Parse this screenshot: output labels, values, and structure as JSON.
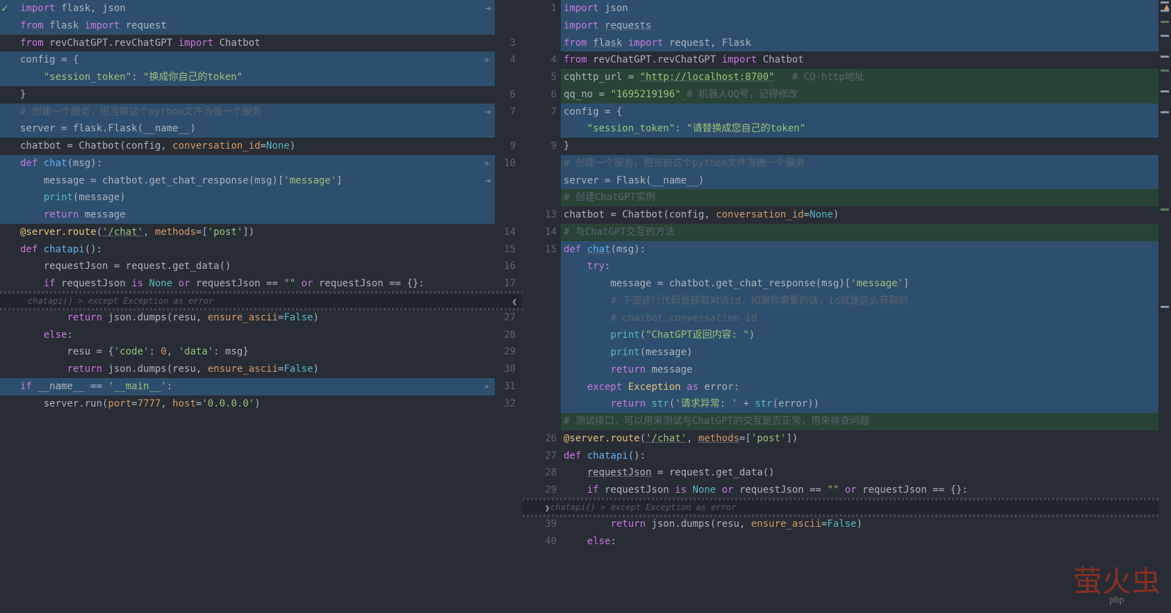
{
  "watermark_main": "萤火虫",
  "watermark_sub": "php",
  "fold_text": "chatapi() > except Exception as error",
  "left": [
    {
      "n": "",
      "t": [
        [
          "kw",
          "import"
        ],
        [
          "plain",
          " flask"
        ],
        [
          "op",
          ", "
        ],
        [
          "plain",
          "json"
        ]
      ],
      "cls": "hl-blue",
      "act": "replace",
      "lm": true
    },
    {
      "n": "",
      "t": [
        [
          "kw",
          "from"
        ],
        [
          "plain",
          " flask "
        ],
        [
          "kw",
          "import"
        ],
        [
          "plain",
          " request"
        ]
      ],
      "cls": "hl-blue",
      "lm": true
    },
    {
      "n": "3",
      "t": [
        [
          "kw",
          "from"
        ],
        [
          "plain",
          " revChatGPT.revChatGPT "
        ],
        [
          "kw",
          "import"
        ],
        [
          "plain",
          " Chatbot"
        ]
      ],
      "cls": ""
    },
    {
      "n": "4",
      "t": [
        [
          "plain",
          "config = {"
        ]
      ],
      "cls": "hl-blue",
      "skip": true,
      "lm": true
    },
    {
      "n": "",
      "t": [
        [
          "plain",
          "    "
        ],
        [
          "str",
          "\"session_token\""
        ],
        [
          "plain",
          ": "
        ],
        [
          "str",
          "\"换成你自己的token\""
        ]
      ],
      "cls": "hl-blue",
      "lm": true
    },
    {
      "n": "6",
      "t": [
        [
          "plain",
          "}"
        ]
      ],
      "cls": ""
    },
    {
      "n": "7",
      "t": [
        [
          "comment",
          "# 创建一个服务，把当前这个python文件当做一个服务"
        ]
      ],
      "cls": "hl-blue",
      "act": "replace",
      "lm": true
    },
    {
      "n": "",
      "t": [
        [
          "plain",
          "server = flask.Flask(__name__)"
        ]
      ],
      "cls": "hl-blue",
      "lm": true
    },
    {
      "n": "9",
      "t": [
        [
          "plain",
          "chatbot = Chatbot(config"
        ],
        [
          "op",
          ", "
        ],
        [
          "param",
          "conversation_id"
        ],
        [
          "plain",
          "="
        ],
        [
          "builtin",
          "None"
        ],
        [
          "plain",
          ")"
        ]
      ],
      "cls": ""
    },
    {
      "n": "10",
      "t": [
        [
          "kw",
          "def "
        ],
        [
          "fn",
          "chat"
        ],
        [
          "plain",
          "(msg):"
        ]
      ],
      "cls": "hl-blue",
      "skip": true,
      "lm": true
    },
    {
      "n": "",
      "t": [
        [
          "plain",
          "    message = chatbot.get_chat_response(msg)["
        ],
        [
          "str",
          "'message'"
        ],
        [
          "plain",
          "]"
        ]
      ],
      "cls": "hl-blue",
      "act": "replace",
      "lm": true
    },
    {
      "n": "",
      "t": [
        [
          "plain",
          "    "
        ],
        [
          "builtin",
          "print"
        ],
        [
          "plain",
          "(message)"
        ]
      ],
      "cls": "hl-blue",
      "lm": true
    },
    {
      "n": "",
      "t": [
        [
          "plain",
          "    "
        ],
        [
          "kw",
          "return"
        ],
        [
          "plain",
          " message"
        ]
      ],
      "cls": "hl-blue",
      "lm": true
    },
    {
      "n": "14",
      "t": [
        [
          "deco",
          "@server.route"
        ],
        [
          "plain",
          "("
        ],
        [
          "str und",
          "'/chat'"
        ],
        [
          "op",
          ", "
        ],
        [
          "param",
          "methods"
        ],
        [
          "plain",
          "=["
        ],
        [
          "str",
          "'post'"
        ],
        [
          "plain",
          "])"
        ]
      ],
      "cls": ""
    },
    {
      "n": "15",
      "t": [
        [
          "kw",
          "def "
        ],
        [
          "fn",
          "chatapi"
        ],
        [
          "plain",
          "():"
        ]
      ],
      "cls": ""
    },
    {
      "n": "16",
      "t": [
        [
          "plain",
          "    requestJson = request.get_data()"
        ]
      ],
      "cls": ""
    },
    {
      "n": "17",
      "t": [
        [
          "plain",
          "    "
        ],
        [
          "kw",
          "if"
        ],
        [
          "plain",
          " requestJson "
        ],
        [
          "kw",
          "is"
        ],
        [
          "plain",
          " "
        ],
        [
          "builtin",
          "None"
        ],
        [
          "plain",
          " "
        ],
        [
          "kw",
          "or"
        ],
        [
          "plain",
          " requestJson == "
        ],
        [
          "str",
          "\"\""
        ],
        [
          "plain",
          " "
        ],
        [
          "kw",
          "or"
        ],
        [
          "plain",
          " requestJson == {}:"
        ]
      ],
      "cls": ""
    },
    {
      "fold": true
    },
    {
      "n": "27",
      "t": [
        [
          "plain",
          "        "
        ],
        [
          "kw",
          "return"
        ],
        [
          "plain",
          " json.dumps(resu"
        ],
        [
          "op",
          ", "
        ],
        [
          "param",
          "ensure_ascii"
        ],
        [
          "plain",
          "="
        ],
        [
          "builtin",
          "False"
        ],
        [
          "plain",
          ")"
        ]
      ],
      "cls": ""
    },
    {
      "n": "28",
      "t": [
        [
          "plain",
          "    "
        ],
        [
          "kw",
          "else"
        ],
        [
          "plain",
          ":"
        ]
      ],
      "cls": ""
    },
    {
      "n": "29",
      "t": [
        [
          "plain",
          "        resu = {"
        ],
        [
          "str",
          "'code'"
        ],
        [
          "plain",
          ": "
        ],
        [
          "num",
          "0"
        ],
        [
          "op",
          ", "
        ],
        [
          "str",
          "'data'"
        ],
        [
          "plain",
          ": msg}"
        ]
      ],
      "cls": ""
    },
    {
      "n": "30",
      "t": [
        [
          "plain",
          "        "
        ],
        [
          "kw",
          "return"
        ],
        [
          "plain",
          " json.dumps(resu"
        ],
        [
          "op",
          ", "
        ],
        [
          "param",
          "ensure_ascii"
        ],
        [
          "plain",
          "="
        ],
        [
          "builtin",
          "False"
        ],
        [
          "plain",
          ")"
        ]
      ],
      "cls": ""
    },
    {
      "n": "31",
      "t": [
        [
          "kw",
          "if"
        ],
        [
          "plain",
          " __name__ == "
        ],
        [
          "str",
          "'__main__'"
        ],
        [
          "plain",
          ":"
        ]
      ],
      "cls": "hl-blue",
      "skip": true,
      "lm": true
    },
    {
      "n": "32",
      "t": [
        [
          "plain",
          "    server.run("
        ],
        [
          "param",
          "port"
        ],
        [
          "plain",
          "="
        ],
        [
          "num",
          "7777"
        ],
        [
          "op",
          ", "
        ],
        [
          "param",
          "host"
        ],
        [
          "plain",
          "="
        ],
        [
          "str",
          "'0.0.0.0'"
        ],
        [
          "plain",
          ")"
        ]
      ],
      "cls": ""
    }
  ],
  "right": [
    {
      "n": "1",
      "t": [
        [
          "kw",
          "import"
        ],
        [
          "plain",
          " json"
        ]
      ],
      "cls": "hl-blue"
    },
    {
      "n": "",
      "t": [
        [
          "kw",
          "import"
        ],
        [
          "plain",
          " "
        ],
        [
          "und plain",
          "requests"
        ]
      ],
      "cls": "hl-blue"
    },
    {
      "n": "",
      "t": [
        [
          "kw",
          "from"
        ],
        [
          "plain",
          " "
        ],
        [
          "und plain",
          "flask"
        ],
        [
          "plain",
          " "
        ],
        [
          "kw",
          "import"
        ],
        [
          "plain",
          " request"
        ],
        [
          "op",
          ", "
        ],
        [
          "plain",
          "Flask"
        ]
      ],
      "cls": "hl-blue"
    },
    {
      "n": "4",
      "t": [
        [
          "kw",
          "from"
        ],
        [
          "plain",
          " revChatGPT.revChatGPT "
        ],
        [
          "kw",
          "import"
        ],
        [
          "plain",
          " Chatbot"
        ]
      ],
      "cls": ""
    },
    {
      "n": "5",
      "t": [
        [
          "plain",
          "cqhttp_url = "
        ],
        [
          "str und",
          "\"http://localhost:8700\""
        ],
        [
          "plain",
          "   "
        ],
        [
          "comment",
          "# CQ-http地址"
        ]
      ],
      "cls": "hl-green"
    },
    {
      "n": "6",
      "t": [
        [
          "plain",
          "qq_no = "
        ],
        [
          "str",
          "\"1695219196\""
        ],
        [
          "comment",
          "_# 机器人QQ号，记得修改"
        ]
      ],
      "cls": "hl-green"
    },
    {
      "n": "7",
      "t": [
        [
          "plain",
          "config = {"
        ]
      ],
      "cls": "hl-blue"
    },
    {
      "n": "",
      "t": [
        [
          "plain",
          "    "
        ],
        [
          "str",
          "\"session_token\""
        ],
        [
          "plain",
          ": "
        ],
        [
          "str",
          "\"请替换成您自己的token\""
        ]
      ],
      "cls": "hl-blue"
    },
    {
      "n": "9",
      "t": [
        [
          "plain",
          "}"
        ]
      ],
      "cls": ""
    },
    {
      "n": "",
      "t": [
        [
          "comment",
          "# 创建一个服务，把当前这个python文件当做一个服务"
        ]
      ],
      "cls": "hl-blue"
    },
    {
      "n": "",
      "t": [
        [
          "plain",
          "server = Flask(__name__)"
        ]
      ],
      "cls": "hl-blue"
    },
    {
      "n": "",
      "t": [
        [
          "comment",
          "# 创建ChatGPT实例"
        ]
      ],
      "cls": "hl-green"
    },
    {
      "n": "13",
      "t": [
        [
          "plain",
          "chatbot = Chatbot(config"
        ],
        [
          "op",
          ", "
        ],
        [
          "param",
          "conversation_id"
        ],
        [
          "plain",
          "="
        ],
        [
          "builtin",
          "None"
        ],
        [
          "plain",
          ")"
        ]
      ],
      "cls": ""
    },
    {
      "n": "14",
      "t": [
        [
          "comment",
          "# 与ChatGPT交互的方法"
        ]
      ],
      "cls": "hl-green"
    },
    {
      "n": "15",
      "t": [
        [
          "kw",
          "def "
        ],
        [
          "fn und",
          "chat"
        ],
        [
          "plain",
          "(msg):"
        ]
      ],
      "cls": "hl-blue"
    },
    {
      "n": "",
      "t": [
        [
          "plain",
          "    "
        ],
        [
          "kw",
          "try"
        ],
        [
          "plain",
          ":"
        ]
      ],
      "cls": "hl-blue"
    },
    {
      "n": "",
      "t": [
        [
          "plain",
          "        message = chatbot.get_chat_response(msg)["
        ],
        [
          "str",
          "'message'"
        ],
        [
          "plain",
          "]"
        ]
      ],
      "cls": "hl-blue"
    },
    {
      "n": "",
      "t": [
        [
          "plain",
          "        "
        ],
        [
          "comment",
          "# 下面这行代码是获取对话id，如果你需要的话，id就是这么获取的"
        ]
      ],
      "cls": "hl-blue"
    },
    {
      "n": "",
      "t": [
        [
          "plain",
          "        "
        ],
        [
          "comment",
          "# chatbot.conversation_id"
        ]
      ],
      "cls": "hl-blue"
    },
    {
      "n": "",
      "t": [
        [
          "plain",
          "        "
        ],
        [
          "builtin",
          "print"
        ],
        [
          "plain",
          "("
        ],
        [
          "str",
          "\"ChatGPT返回内容: \""
        ],
        [
          "plain",
          ")"
        ]
      ],
      "cls": "hl-blue"
    },
    {
      "n": "",
      "t": [
        [
          "plain",
          "        "
        ],
        [
          "builtin",
          "print"
        ],
        [
          "plain",
          "(message)"
        ]
      ],
      "cls": "hl-blue"
    },
    {
      "n": "",
      "t": [
        [
          "plain",
          "        "
        ],
        [
          "kw",
          "return"
        ],
        [
          "plain",
          " message"
        ]
      ],
      "cls": "hl-blue"
    },
    {
      "n": "",
      "t": [
        [
          "plain",
          "    "
        ],
        [
          "kw",
          "except"
        ],
        [
          "plain",
          " "
        ],
        [
          "self",
          "Exception"
        ],
        [
          "plain",
          " "
        ],
        [
          "kw",
          "as"
        ],
        [
          "plain",
          " error:"
        ]
      ],
      "cls": "hl-blue"
    },
    {
      "n": "",
      "t": [
        [
          "plain",
          "        "
        ],
        [
          "kw",
          "return"
        ],
        [
          "plain",
          " "
        ],
        [
          "builtin",
          "str"
        ],
        [
          "plain",
          "("
        ],
        [
          "str",
          "'请求异常: '"
        ],
        [
          "plain",
          " + "
        ],
        [
          "builtin",
          "str"
        ],
        [
          "plain",
          "(error))"
        ]
      ],
      "cls": "hl-blue"
    },
    {
      "n": "",
      "t": [
        [
          "comment",
          "# 测试接口，可以用来测试与ChatGPT的交互是否正常，用来排查问题"
        ]
      ],
      "cls": "hl-green"
    },
    {
      "n": "26",
      "t": [
        [
          "deco",
          "@server.route"
        ],
        [
          "plain",
          "("
        ],
        [
          "str und",
          "'/chat'"
        ],
        [
          "op",
          ", "
        ],
        [
          "param und",
          "methods"
        ],
        [
          "plain",
          "=["
        ],
        [
          "str",
          "'post'"
        ],
        [
          "plain",
          "])"
        ]
      ],
      "cls": ""
    },
    {
      "n": "27",
      "t": [
        [
          "kw",
          "def "
        ],
        [
          "fn",
          "chatapi"
        ],
        [
          "plain",
          "():"
        ]
      ],
      "cls": ""
    },
    {
      "n": "28",
      "t": [
        [
          "plain",
          "    "
        ],
        [
          "und plain",
          "requestJson"
        ],
        [
          "plain",
          " = request.get_data()"
        ]
      ],
      "cls": ""
    },
    {
      "n": "29",
      "t": [
        [
          "plain",
          "    "
        ],
        [
          "kw",
          "if"
        ],
        [
          "plain",
          " requestJson "
        ],
        [
          "kw",
          "is"
        ],
        [
          "plain",
          " "
        ],
        [
          "builtin",
          "None"
        ],
        [
          "plain",
          " "
        ],
        [
          "kw",
          "or"
        ],
        [
          "plain",
          " requestJson == "
        ],
        [
          "str",
          "\"\""
        ],
        [
          "plain",
          " "
        ],
        [
          "kw",
          "or"
        ],
        [
          "plain",
          " requestJson == {}:"
        ]
      ],
      "cls": ""
    },
    {
      "fold": true
    },
    {
      "n": "39",
      "t": [
        [
          "plain",
          "        "
        ],
        [
          "kw",
          "return"
        ],
        [
          "plain",
          " json.dumps(resu"
        ],
        [
          "op",
          ", "
        ],
        [
          "param",
          "ensure_ascii"
        ],
        [
          "plain",
          "="
        ],
        [
          "builtin",
          "False"
        ],
        [
          "plain",
          ")"
        ]
      ],
      "cls": ""
    },
    {
      "n": "40",
      "t": [
        [
          "plain",
          "    "
        ],
        [
          "kw",
          "else"
        ],
        [
          "plain",
          ":"
        ]
      ],
      "cls": ""
    }
  ]
}
